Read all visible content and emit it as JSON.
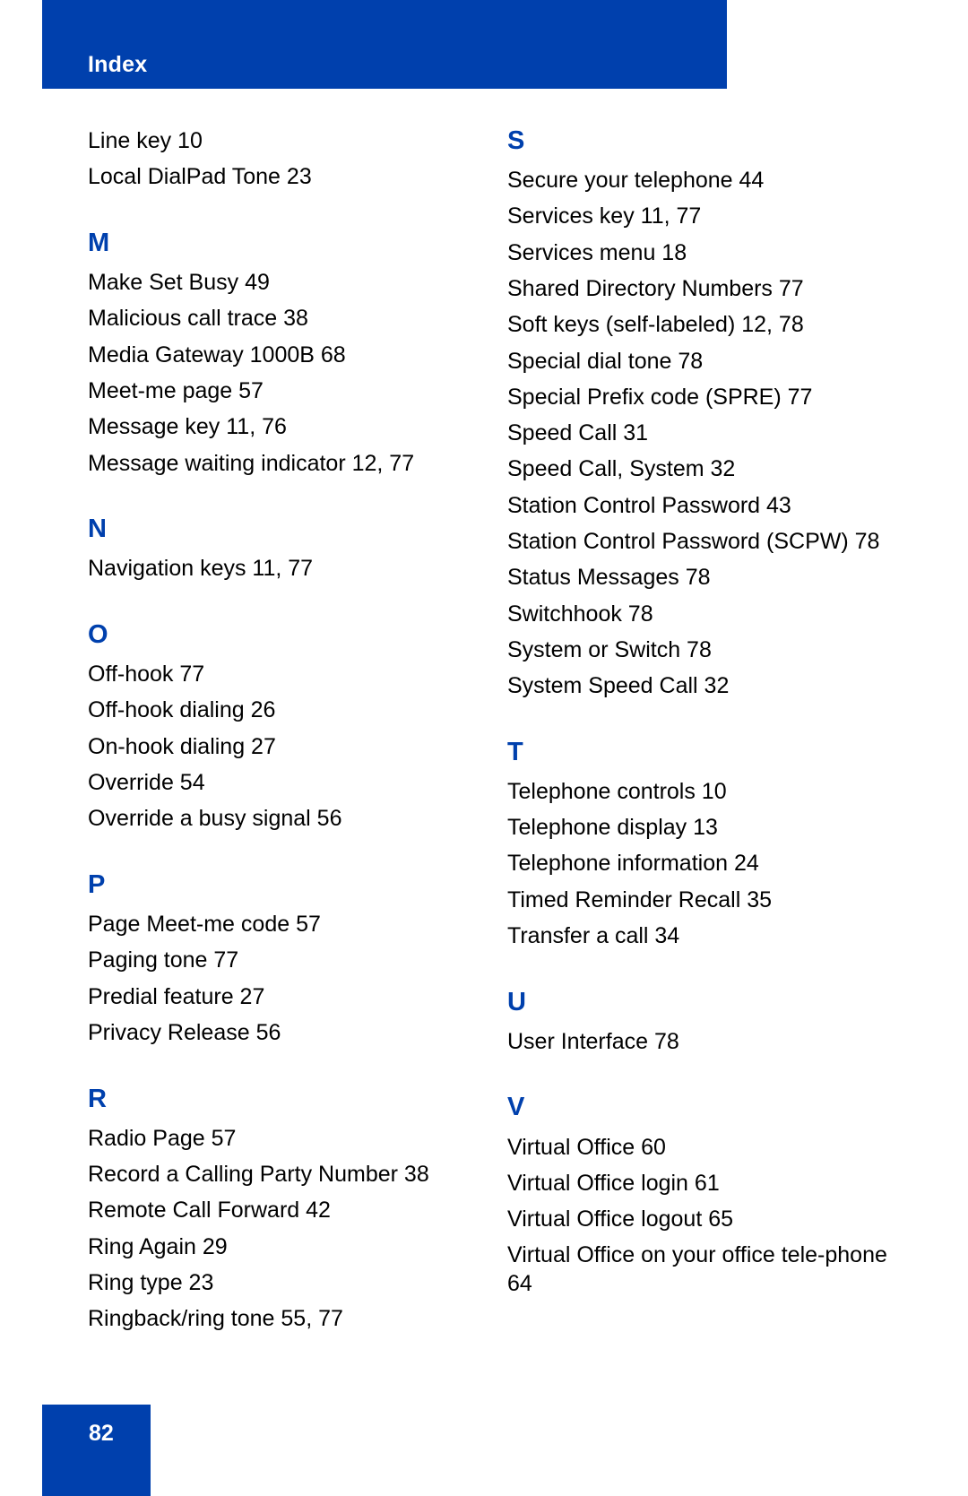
{
  "header": {
    "title": "Index"
  },
  "colors": {
    "accent": "#0040ad",
    "text": "#000000",
    "background": "#ffffff"
  },
  "left_column": {
    "continued_entries": [
      "Line key 10",
      "Local DialPad Tone 23"
    ],
    "sections": [
      {
        "letter": "M",
        "entries": [
          "Make Set Busy 49",
          "Malicious call trace 38",
          "Media Gateway 1000B 68",
          "Meet-me page 57",
          "Message key 11, 76",
          "Message waiting indicator 12, 77"
        ]
      },
      {
        "letter": "N",
        "entries": [
          "Navigation keys 11, 77"
        ]
      },
      {
        "letter": "O",
        "entries": [
          "Off-hook 77",
          "Off-hook dialing 26",
          "On-hook dialing 27",
          "Override 54",
          "Override a busy signal 56"
        ]
      },
      {
        "letter": "P",
        "entries": [
          "Page Meet-me code 57",
          "Paging tone 77",
          "Predial feature 27",
          "Privacy Release 56"
        ]
      },
      {
        "letter": "R",
        "entries": [
          "Radio Page 57",
          "Record a Calling Party Number 38",
          "Remote Call Forward 42",
          "Ring Again 29",
          "Ring type 23",
          "Ringback/ring tone 55, 77"
        ]
      }
    ]
  },
  "right_column": {
    "sections": [
      {
        "letter": "S",
        "entries": [
          "Secure your telephone 44",
          "Services key 11, 77",
          "Services menu 18",
          "Shared Directory Numbers 77",
          "Soft keys (self-labeled) 12, 78",
          "Special dial tone 78",
          "Special Prefix code (SPRE) 77",
          "Speed Call 31",
          "Speed Call, System 32",
          "Station Control Password 43",
          "Station Control Password (SCPW) 78",
          "Status Messages 78",
          "Switchhook 78",
          "System or Switch 78",
          "System Speed Call 32"
        ]
      },
      {
        "letter": "T",
        "entries": [
          "Telephone controls 10",
          "Telephone display 13",
          "Telephone information 24",
          "Timed Reminder Recall 35",
          "Transfer a call 34"
        ]
      },
      {
        "letter": "U",
        "entries": [
          "User Interface 78"
        ]
      },
      {
        "letter": "V",
        "entries": [
          "Virtual Office 60",
          "Virtual Office login 61",
          "Virtual Office logout 65",
          "Virtual Office on your office tele-phone 64"
        ]
      }
    ]
  },
  "footer": {
    "page_number": "82"
  }
}
